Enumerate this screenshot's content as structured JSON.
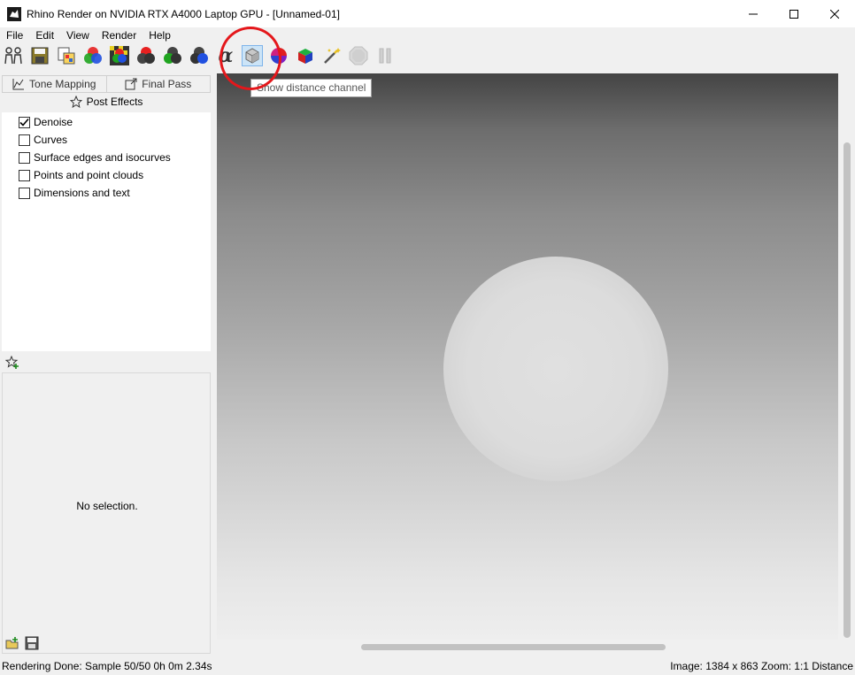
{
  "window": {
    "title": "Rhino Render on NVIDIA RTX A4000 Laptop GPU - [Unnamed-01]"
  },
  "menu": [
    "File",
    "Edit",
    "View",
    "Render",
    "Help"
  ],
  "toolbar": {
    "tooltip": "Show distance channel",
    "alpha_symbol": "α",
    "buttons": [
      "compare-icon",
      "save-icon",
      "image-icon",
      "rgb-channel-icon",
      "rgb-checker-icon",
      "red-channel-icon",
      "green-channel-icon",
      "blue-channel-icon",
      "alpha-icon",
      "distance-channel-icon",
      "normal-channel-icon",
      "cube-channel-icon",
      "magic-wand-icon",
      "stop-icon",
      "pause-icon"
    ]
  },
  "left_panel": {
    "tabs": [
      "Tone Mapping",
      "Final Pass"
    ],
    "section_title": "Post Effects",
    "effects": [
      {
        "label": "Denoise",
        "checked": true
      },
      {
        "label": "Curves",
        "checked": false
      },
      {
        "label": "Surface edges and isocurves",
        "checked": false
      },
      {
        "label": "Points and point clouds",
        "checked": false
      },
      {
        "label": "Dimensions and text",
        "checked": false
      }
    ],
    "no_selection": "No selection."
  },
  "status": {
    "left": "Rendering Done: Sample 50/50 0h 0m 2.34s",
    "right": "Image: 1384 x 863  Zoom: 1:1  Distance"
  },
  "colors": {
    "annotation": "#e4171b",
    "active_button": "#cce4f7"
  }
}
